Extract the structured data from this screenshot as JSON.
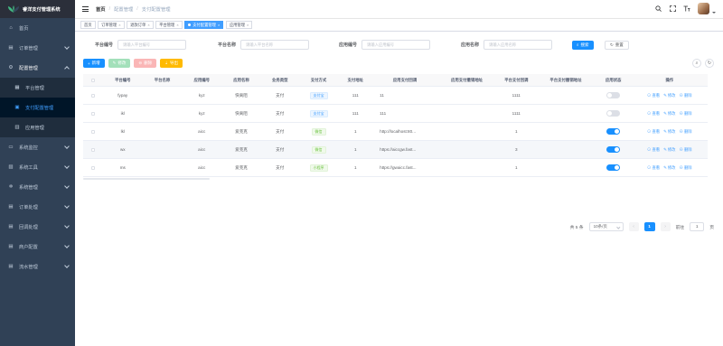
{
  "app": {
    "title": "睿洋支付管理系统"
  },
  "sidebar": {
    "items": [
      {
        "label": "首页",
        "icon": "home-icon"
      },
      {
        "label": "订单管理",
        "icon": "order-icon"
      },
      {
        "label": "配置管理",
        "icon": "config-icon"
      },
      {
        "label": "平台管理",
        "icon": "platform-icon"
      },
      {
        "label": "支付配置管理",
        "icon": "pay-config-icon"
      },
      {
        "label": "应用管理",
        "icon": "app-icon"
      },
      {
        "label": "系统监控",
        "icon": "monitor-icon"
      },
      {
        "label": "系统工具",
        "icon": "tool-icon"
      },
      {
        "label": "系统管理",
        "icon": "system-icon"
      },
      {
        "label": "订单处理",
        "icon": "process-icon"
      },
      {
        "label": "回调处理",
        "icon": "callback-icon"
      },
      {
        "label": "商户配置",
        "icon": "merchant-icon"
      },
      {
        "label": "流水管理",
        "icon": "flow-icon"
      }
    ]
  },
  "header": {
    "breadcrumb": [
      "首页",
      "配置管理",
      "支付配置管理"
    ]
  },
  "tags": [
    {
      "label": "首页"
    },
    {
      "label": "订单管理"
    },
    {
      "label": "退款订单"
    },
    {
      "label": "平台管理"
    },
    {
      "label": "支付配置管理"
    },
    {
      "label": "应用管理"
    }
  ],
  "search": {
    "platform_no": {
      "label": "平台编号",
      "placeholder": "请输入平台编号"
    },
    "platform_name": {
      "label": "平台名称",
      "placeholder": "请输入平台名称"
    },
    "app_no": {
      "label": "应用编号",
      "placeholder": "请输入应用编号"
    },
    "app_name": {
      "label": "应用名称",
      "placeholder": "请输入应用名称"
    },
    "search_btn": "搜索",
    "reset_btn": "重置"
  },
  "toolbar": {
    "add": "新增",
    "edit": "修改",
    "delete": "删除",
    "export": "导出"
  },
  "table": {
    "headers": [
      "平台编号",
      "平台名称",
      "应用编号",
      "应用名称",
      "业务类型",
      "支付方式",
      "支付地址",
      "应用支付回调",
      "应用支付撤销地址",
      "平台支付回调",
      "平台支付撤销地址",
      "应用状态",
      "操作"
    ],
    "rows": [
      {
        "platform_no": "fypay",
        "platform_name": "",
        "app_no": "kyz",
        "app_name": "快离阻",
        "biz": "支付",
        "pay": "支付宝",
        "pay_color": "blue",
        "pay_addr": "111",
        "app_cb": "11",
        "app_cancel": "",
        "plat_cb": "1111",
        "plat_cancel": "",
        "enabled": false
      },
      {
        "platform_no": "ikl",
        "platform_name": "",
        "app_no": "kyz",
        "app_name": "快离阻",
        "biz": "支付",
        "pay": "支付宝",
        "pay_color": "blue",
        "pay_addr": "111",
        "app_cb": "111",
        "app_cancel": "",
        "plat_cb": "1111",
        "plat_cancel": "",
        "enabled": false
      },
      {
        "platform_no": "lkl",
        "platform_name": "",
        "app_no": "aicc",
        "app_name": "爱克克",
        "biz": "支付",
        "pay": "微信",
        "pay_color": "green",
        "pay_addr": "1",
        "app_cb": "http://localhost:80...",
        "app_cancel": "",
        "plat_cb": "1",
        "plat_cancel": "",
        "enabled": true
      },
      {
        "platform_no": "wx",
        "platform_name": "",
        "app_no": "aicc",
        "app_name": "爱克克",
        "biz": "支付",
        "pay": "微信",
        "pay_color": "green",
        "pay_addr": "1",
        "app_cb": "https://aiccgw.fast...",
        "app_cancel": "",
        "plat_cb": "3",
        "plat_cancel": "",
        "enabled": true
      },
      {
        "platform_no": "ms",
        "platform_name": "",
        "app_no": "aicc",
        "app_name": "爱克克",
        "biz": "支付",
        "pay": "小程序",
        "pay_color": "green",
        "pay_addr": "1",
        "app_cb": "https://gwaicc.fast...",
        "app_cancel": "",
        "plat_cb": "1",
        "plat_cancel": "",
        "enabled": true
      }
    ],
    "ops": {
      "view": "查看",
      "edit": "修改",
      "delete": "删除"
    }
  },
  "pager": {
    "total": "共 5 条",
    "page_size": "10条/页",
    "current": "1",
    "goto": "前往",
    "goto_value": "1",
    "page_unit": "页"
  },
  "colors": {
    "primary": "#1890ff",
    "sidebar": "#304156",
    "active": "#409eff"
  }
}
